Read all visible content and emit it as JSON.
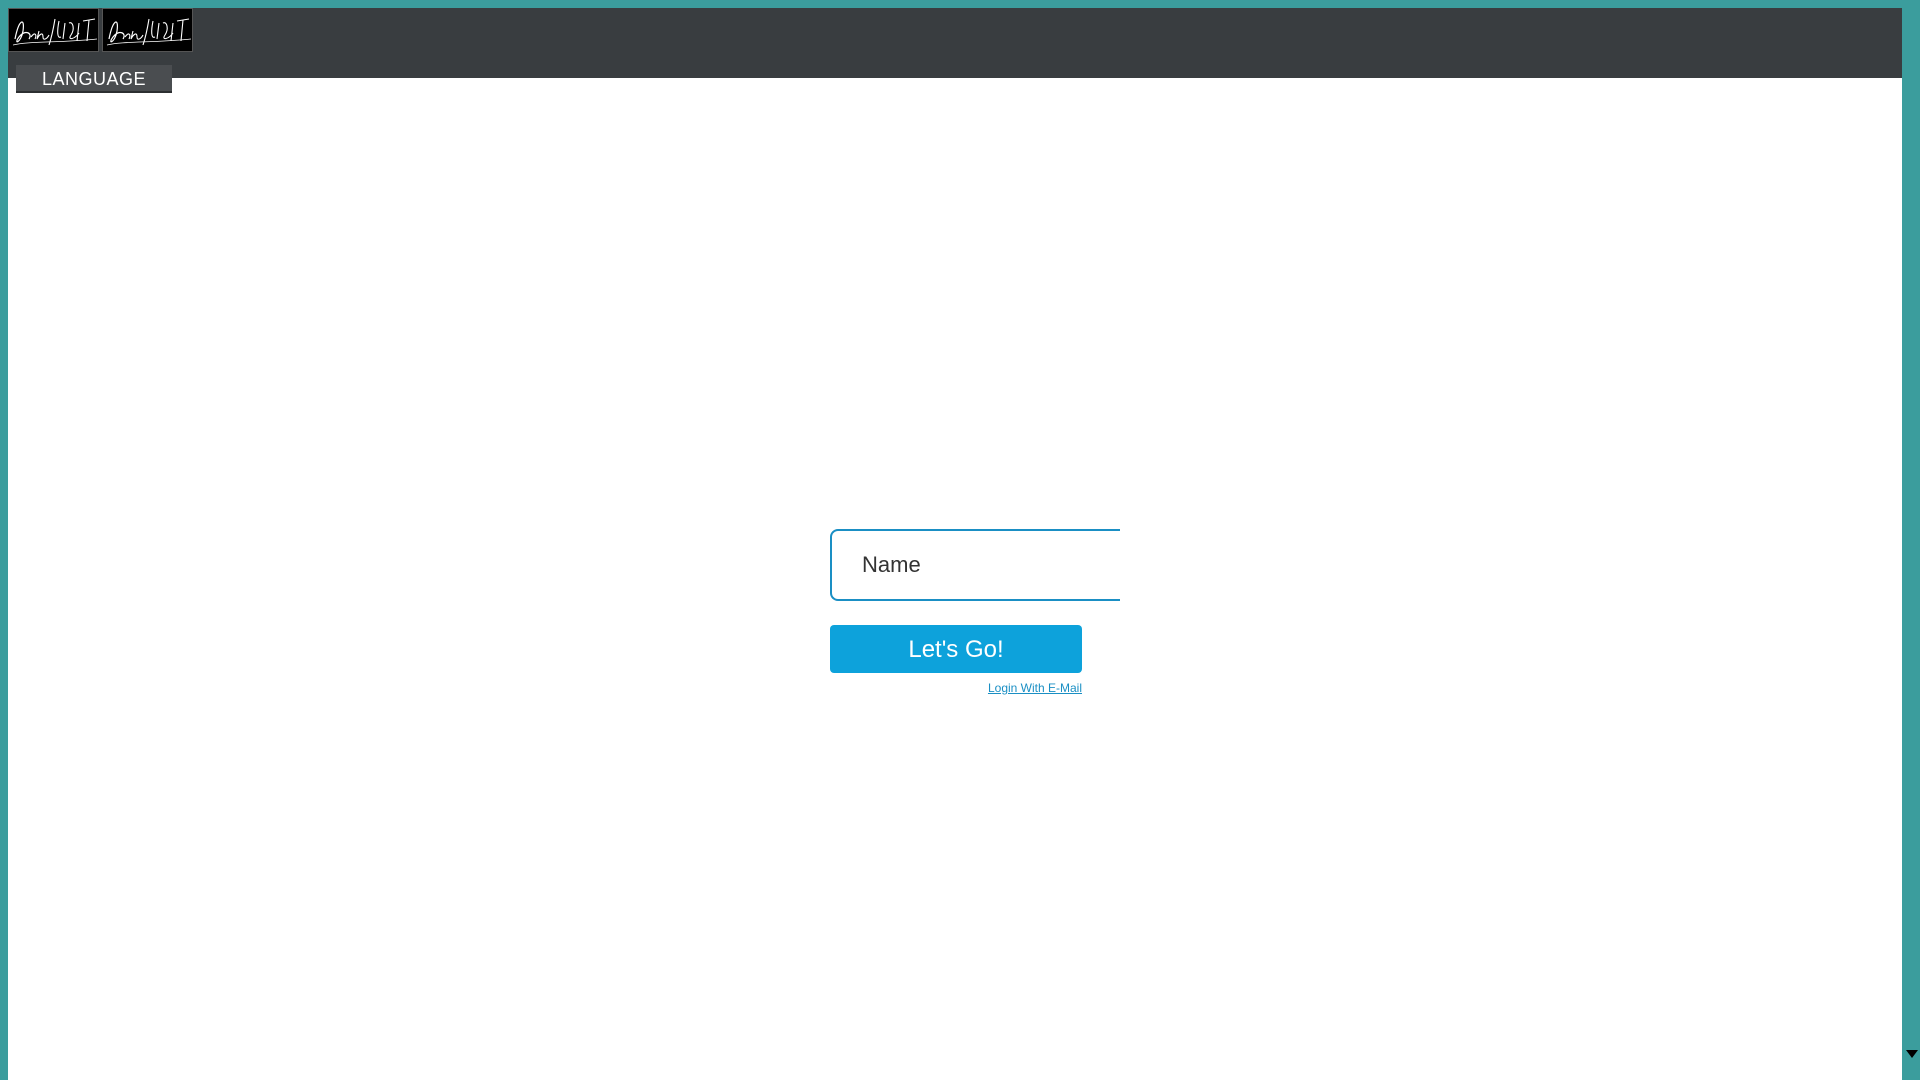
{
  "header": {
    "logos": [
      "live-light-logo",
      "live-light-logo"
    ],
    "logo_alt_text": "Live Light"
  },
  "language_button": {
    "label": "LANGUAGE"
  },
  "login": {
    "name_placeholder": "Name",
    "go_button_label": "Let's Go!",
    "email_link_label": "Login With E-Mail"
  },
  "colors": {
    "frame": "#3b9d9d",
    "header": "#393d40",
    "accent": "#0da2db",
    "input_border": "#1a8fc4",
    "language_button": "#4a4d50"
  }
}
